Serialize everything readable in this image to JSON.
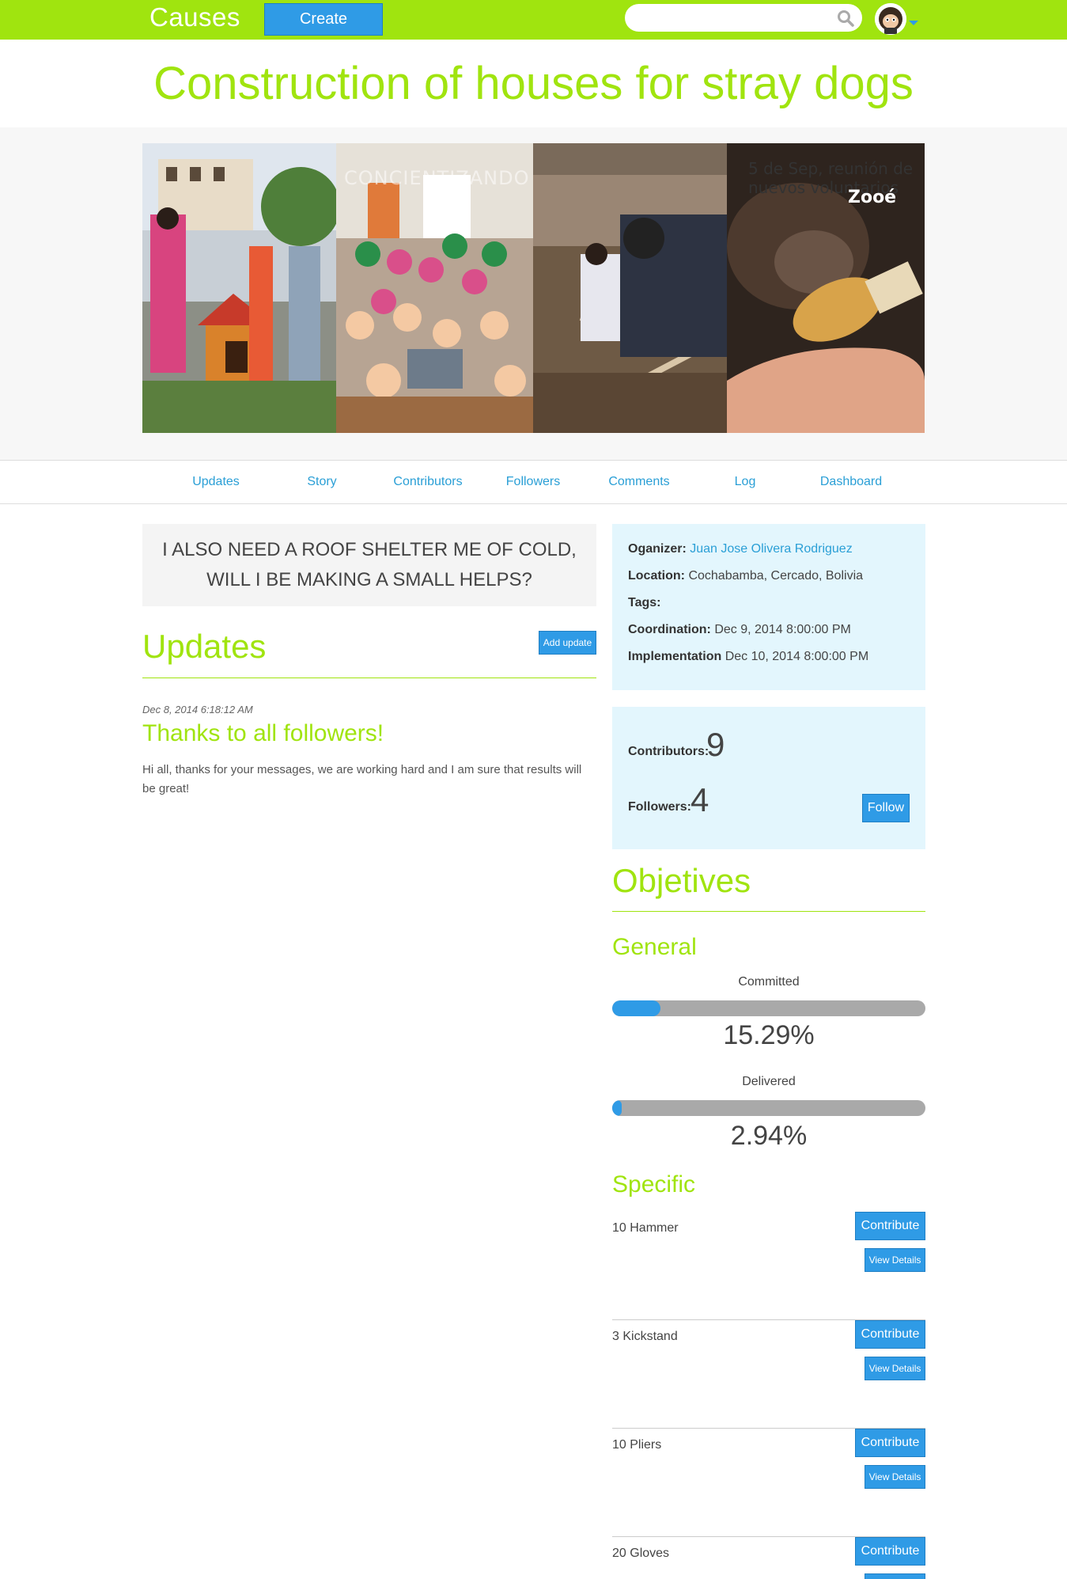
{
  "header": {
    "brand": "Causes",
    "create_label": "Create",
    "search_placeholder": ""
  },
  "page": {
    "title": "Construction of houses for stray dogs"
  },
  "banner": {
    "overlay_text": "CONCIENTIZANDO",
    "caption": "5 de Sep,  reunión de nuevos voluntarios",
    "logo_text": "Zooé"
  },
  "tabs": [
    "Updates",
    "Story",
    "Contributors",
    "Followers",
    "Comments",
    "Log",
    "Dashboard"
  ],
  "tagline": {
    "line1": "I ALSO NEED A ROOF SHELTER ME OF COLD,",
    "line2": "WILL I BE MAKING A SMALL HELPS?"
  },
  "updates": {
    "heading": "Updates",
    "add_label": "Add update",
    "items": [
      {
        "date": "Dec 8, 2014 6:18:12 AM",
        "title": "Thanks to all followers!",
        "body": "Hi all, thanks for your messages, we are working hard and I am sure that results will be great!"
      }
    ]
  },
  "info": {
    "organizer_label": "Oganizer:",
    "organizer_value": "Juan Jose Olivera Rodriguez",
    "location_label": "Location:",
    "location_value": "Cochabamba, Cercado, Bolivia",
    "tags_label": "Tags:",
    "tags_value": "",
    "coordination_label": "Coordination:",
    "coordination_value": "Dec 9, 2014 8:00:00 PM",
    "implementation_label": "Implementation",
    "implementation_value": "Dec 10, 2014 8:00:00 PM"
  },
  "stats": {
    "contributors_label": "Contributors:",
    "contributors_value": "9",
    "followers_label": "Followers:",
    "followers_value": "4",
    "follow_label": "Follow"
  },
  "objectives": {
    "heading": "Objetives",
    "general_heading": "General",
    "committed_label": "Committed",
    "committed_pct": "15.29%",
    "committed_fraction": 0.1529,
    "delivered_label": "Delivered",
    "delivered_pct": "2.94%",
    "delivered_fraction": 0.0294,
    "specific_heading": "Specific",
    "contribute_label": "Contribute",
    "details_label": "View Details",
    "items": [
      {
        "name": "10 Hammer"
      },
      {
        "name": "3 Kickstand"
      },
      {
        "name": "10 Pliers"
      },
      {
        "name": "20 Gloves"
      }
    ]
  },
  "colors": {
    "accent_green": "#a0e40f",
    "button_blue": "#2f9be6",
    "link_blue": "#2a9fd6",
    "info_bg": "#e3f6fd"
  }
}
